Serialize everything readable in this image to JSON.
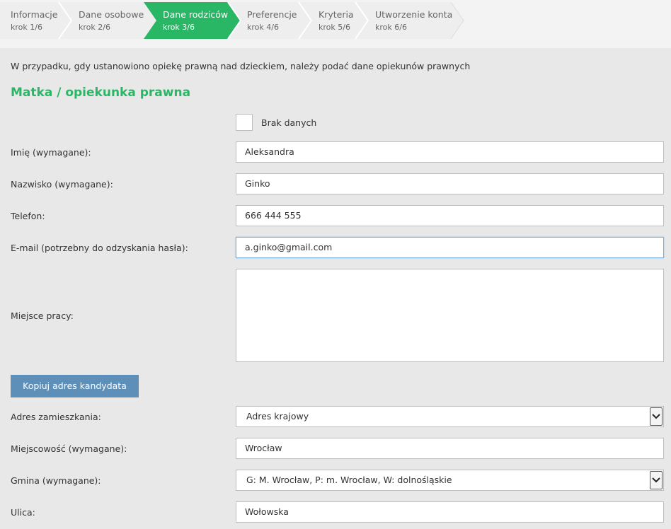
{
  "stepper": {
    "steps": [
      {
        "label": "Informacje",
        "sub": "krok 1/6"
      },
      {
        "label": "Dane osobowe",
        "sub": "krok 2/6"
      },
      {
        "label": "Dane rodziców",
        "sub": "krok 3/6"
      },
      {
        "label": "Preferencje",
        "sub": "krok 4/6"
      },
      {
        "label": "Kryteria",
        "sub": "krok 5/6"
      },
      {
        "label": "Utworzenie konta",
        "sub": "krok 6/6"
      }
    ],
    "active_index": 2,
    "active_color": "#29b765"
  },
  "intro_text": "W przypadku, gdy ustanowiono opiekę prawną nad dzieckiem, należy podać dane opiekunów prawnych",
  "section_title": "Matka / opiekunka prawna",
  "no_data": {
    "label": "Brak danych",
    "checked": false
  },
  "fields": {
    "first_name": {
      "label": "Imię (wymagane):",
      "value": "Aleksandra"
    },
    "last_name": {
      "label": "Nazwisko (wymagane):",
      "value": "Ginko"
    },
    "phone": {
      "label": "Telefon:",
      "value": "666 444 555"
    },
    "email": {
      "label": "E-mail (potrzebny do odzyskania hasła):",
      "value": "a.ginko@gmail.com"
    },
    "workplace": {
      "label": "Miejsce pracy:",
      "value": ""
    },
    "address_type": {
      "label": "Adres zamieszkania:",
      "value": "Adres krajowy"
    },
    "city": {
      "label": "Miejscowość (wymagane):",
      "value": "Wrocław"
    },
    "commune": {
      "label": "Gmina (wymagane):",
      "value": "G: M. Wrocław, P: m. Wrocław, W: dolnośląskie"
    },
    "street": {
      "label": "Ulica:",
      "value": "Wołowska"
    }
  },
  "copy_button_label": "Kopiuj adres kandydata"
}
